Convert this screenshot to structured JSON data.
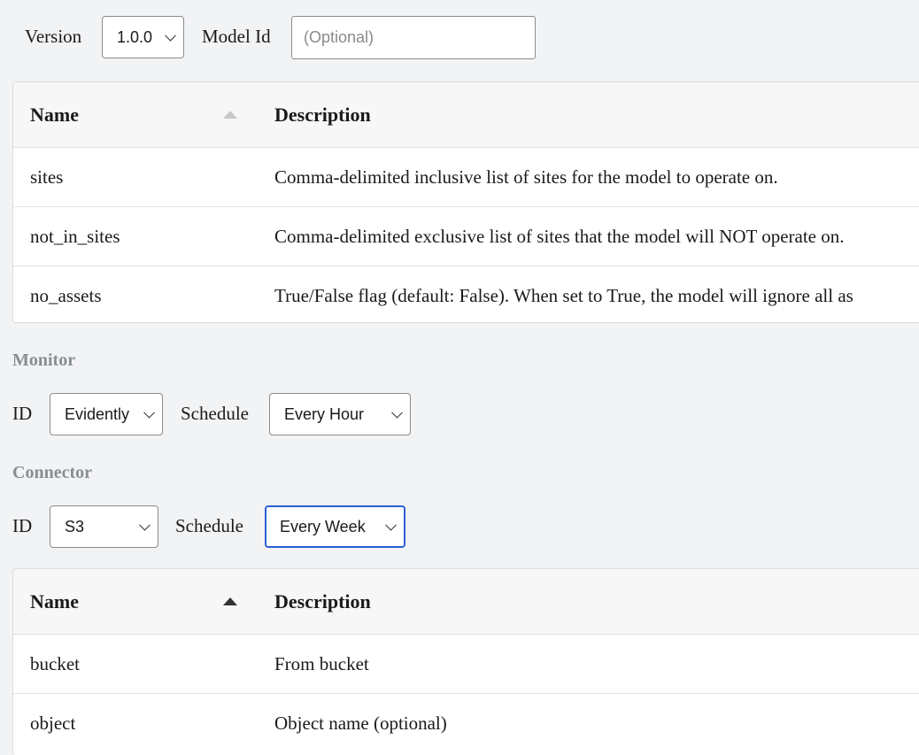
{
  "model": {
    "version_label": "Version",
    "version_value": "1.0.0",
    "model_id_label": "Model Id",
    "model_id_placeholder": "(Optional)"
  },
  "params_table": {
    "headers": {
      "name": "Name",
      "description": "Description"
    },
    "rows": [
      {
        "name": "sites",
        "description": "Comma-delimited inclusive list of sites for the model to operate on."
      },
      {
        "name": "not_in_sites",
        "description": "Comma-delimited exclusive list of sites that the model will NOT operate on."
      },
      {
        "name": "no_assets",
        "description": "True/False flag (default: False). When set to True, the model will ignore all as"
      }
    ]
  },
  "monitor": {
    "title": "Monitor",
    "id_label": "ID",
    "id_value": "Evidently",
    "schedule_label": "Schedule",
    "schedule_value": "Every Hour"
  },
  "connector": {
    "title": "Connector",
    "id_label": "ID",
    "id_value": "S3",
    "schedule_label": "Schedule",
    "schedule_value": "Every Week"
  },
  "connector_table": {
    "headers": {
      "name": "Name",
      "description": "Description"
    },
    "rows": [
      {
        "name": "bucket",
        "description": "From bucket"
      },
      {
        "name": "object",
        "description": "Object name (optional)"
      }
    ]
  },
  "colors": {
    "background": "#f2f3f5",
    "focus_border": "#2b5fd9",
    "section_title": "#8a8d91"
  }
}
